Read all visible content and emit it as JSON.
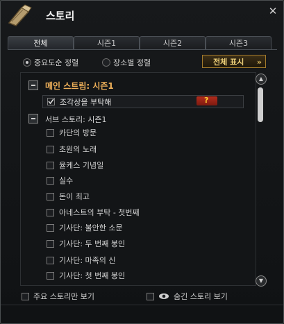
{
  "window": {
    "title": "스토리"
  },
  "tabs": [
    {
      "label": "전체",
      "active": true
    },
    {
      "label": "시즌1",
      "active": false
    },
    {
      "label": "시즌2",
      "active": false
    },
    {
      "label": "시즌3",
      "active": false
    }
  ],
  "sort": {
    "by_importance": "중요도순 정렬",
    "by_location": "장소별 정렬",
    "selected": "by_importance"
  },
  "show_all_button": {
    "label": "전체 표시",
    "arrow": "»"
  },
  "main_story": {
    "header": "메인 스트림: 시즌1",
    "item_label": "조각상을 부탁해",
    "badge": "?"
  },
  "sub_story": {
    "header": "서브 스토리: 시즌1",
    "items": [
      "카단의 방문",
      "초원의 노래",
      "율케스 기념일",
      "실수",
      "돈이 최고",
      "아네스트의 부탁 - 첫번째",
      "기사단: 불안한 소문",
      "기사단: 두 번째 봉인",
      "기사단: 마족의 신",
      "기사단: 첫 번째 봉인"
    ]
  },
  "footer": {
    "main_only": "주요 스토리만 보기",
    "hidden_story": "숨긴 스토리 보기"
  },
  "colors": {
    "main_header": "#f0b15a",
    "show_all_text": "#f0d27a",
    "badge_bg": "#b22c1c"
  }
}
